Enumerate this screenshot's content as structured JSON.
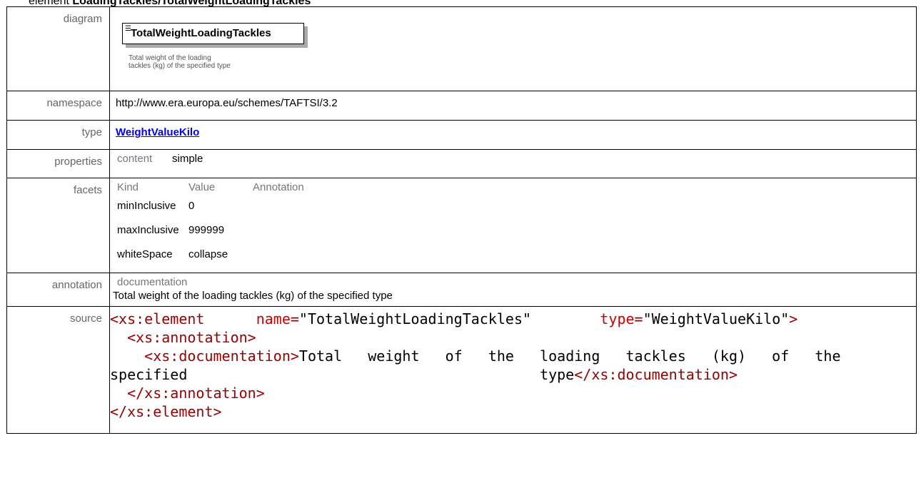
{
  "heading": {
    "prefix": "element",
    "path": "LoadingTackles/TotalWeightLoadingTackles"
  },
  "rows": {
    "diagram": {
      "label": "diagram",
      "element_name": "TotalWeightLoadingTackles",
      "note_line1": "Total weight of the loading",
      "note_line2": "tackles (kg) of the specified type"
    },
    "namespace": {
      "label": "namespace",
      "value": "http://www.era.europa.eu/schemes/TAFTSI/3.2"
    },
    "type": {
      "label": "type",
      "value": "WeightValueKilo"
    },
    "properties": {
      "label": "properties",
      "key": "content",
      "value": "simple"
    },
    "facets": {
      "label": "facets",
      "headers": [
        "Kind",
        "Value",
        "Annotation"
      ],
      "rows": [
        {
          "kind": "minInclusive",
          "value": "0"
        },
        {
          "kind": "maxInclusive",
          "value": "999999"
        },
        {
          "kind": "whiteSpace",
          "value": "collapse"
        }
      ]
    },
    "annotation": {
      "label": "annotation",
      "head": "documentation",
      "text": "Total weight of the loading tackles (kg) of the specified type"
    },
    "source": {
      "label": "source",
      "line1_open": "<xs:element",
      "attr_name": "name",
      "attr_name_val": "\"TotalWeightLoadingTackles\"",
      "attr_type": "type",
      "attr_type_val": "\"WeightValueKilo\"",
      "close": ">",
      "line2": "<xs:annotation>",
      "line3_tag": "<xs:documentation>",
      "line3_text": "Total   weight   of   the   loading   tackles   (kg)   of   the",
      "line4_text": "specified",
      "line4_end": "type",
      "line4_close": "</xs:documentation>",
      "line5": "</xs:annotation>",
      "line6": "</xs:element>"
    }
  }
}
